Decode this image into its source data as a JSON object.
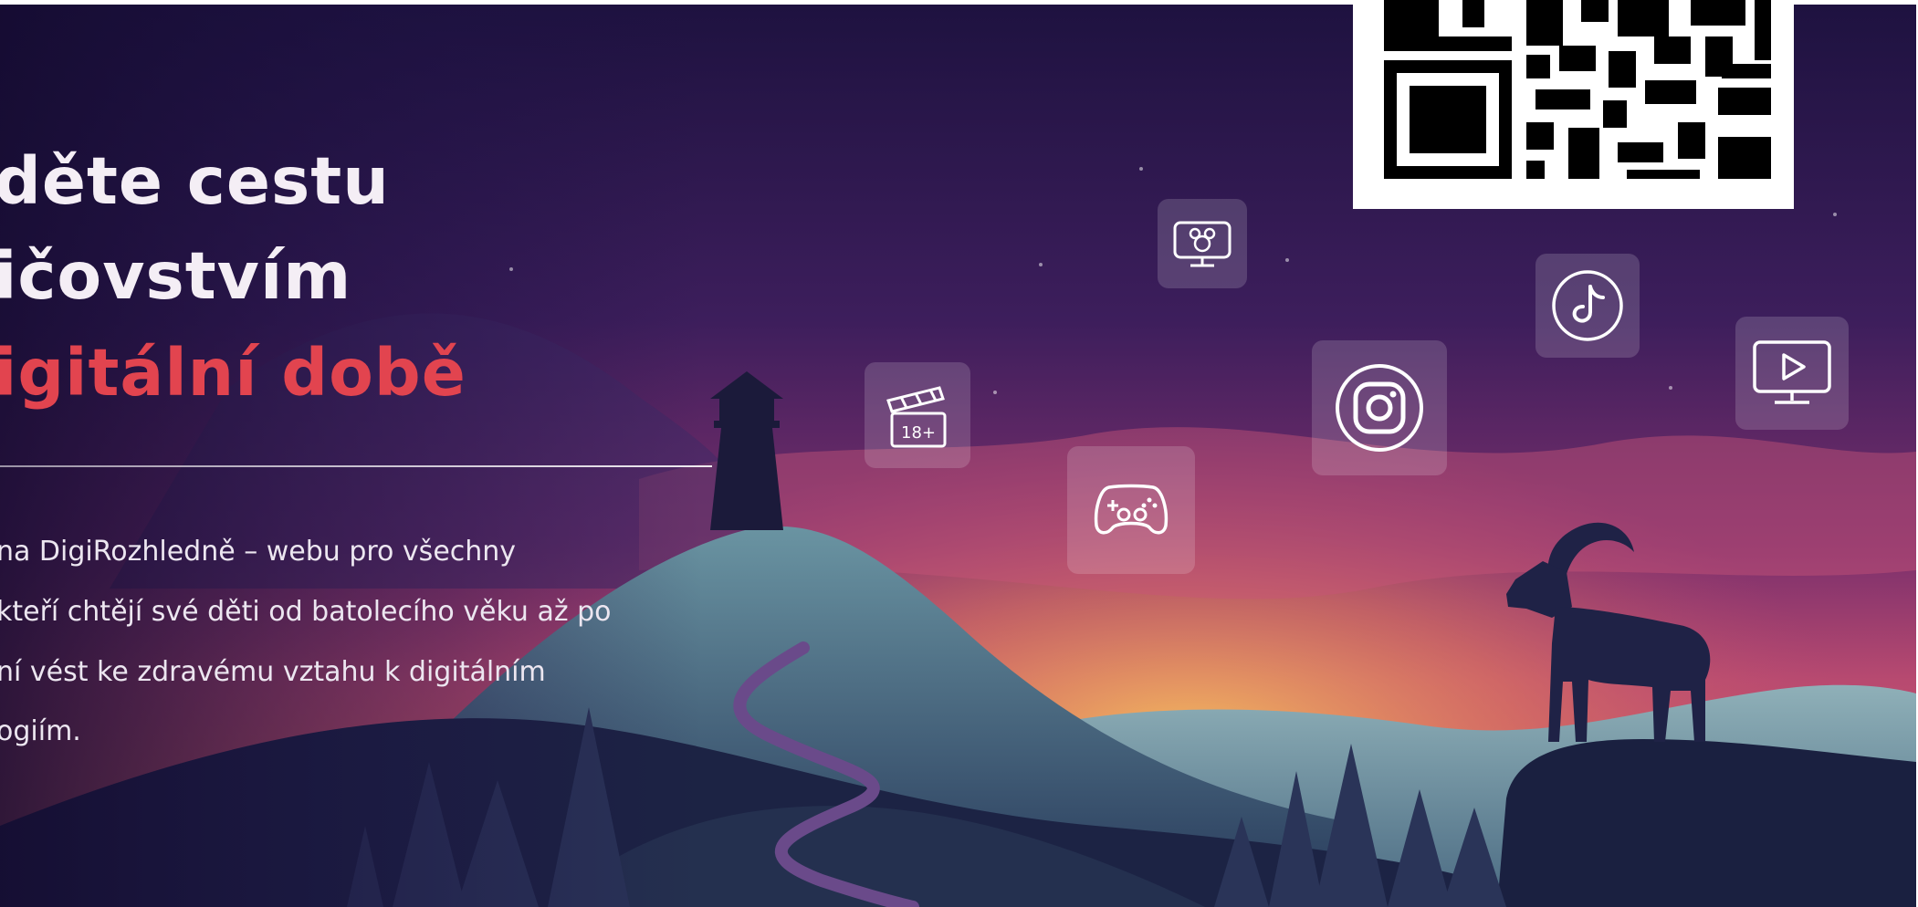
{
  "hero": {
    "headline": {
      "line1": "děte cestu",
      "line2": "ičovstvím",
      "line3": "igitální době"
    },
    "body": {
      "line1": "na DigiRozhledně – webu pro všechny",
      "line2": "kteří chtějí své děti od batolecího věku až po",
      "line3": "ní vést ke zdravému vztahu k digitálním",
      "line4": "ogiím."
    }
  },
  "tiles": {
    "movie_rating_label": "18+"
  },
  "icons": [
    "tv-character-icon",
    "movie-18-icon",
    "gamepad-icon",
    "instagram-icon",
    "tiktok-icon",
    "video-play-icon",
    "qr-code"
  ],
  "colors": {
    "sky_top": "#1e1240",
    "sky_mid": "#5a2a6e",
    "sky_glow": "#c24d72",
    "horizon": "#f0b45a",
    "headline_text": "#f4eef5",
    "headline_accent": "#e2444f",
    "body_text": "#ece6f0",
    "hills_dark": "#1c2344",
    "hills_teal": "#3f6a80"
  }
}
